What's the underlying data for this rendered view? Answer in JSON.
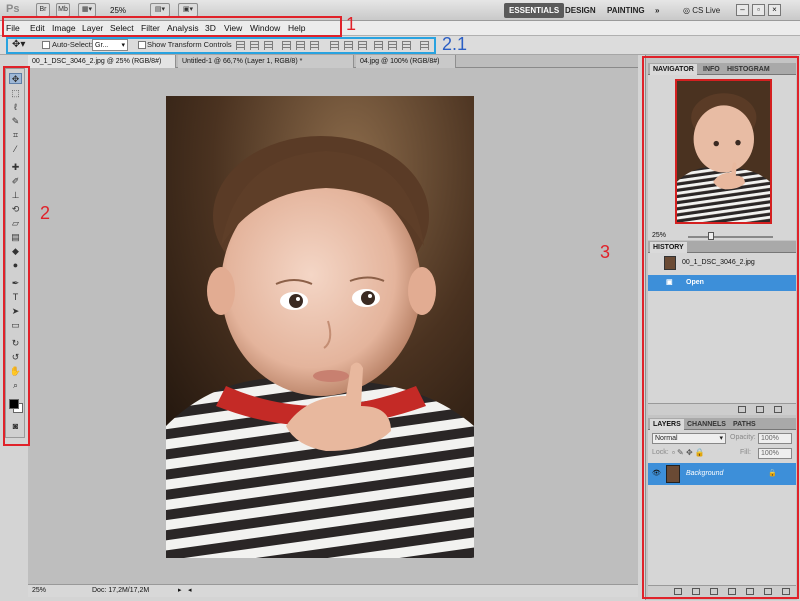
{
  "appbar": {
    "logo": "Ps",
    "zoom": "25%",
    "workspaces": [
      "ESSENTIALS",
      "DESIGN",
      "PAINTING"
    ],
    "more": "»",
    "cslive": "CS Live"
  },
  "menus": [
    "File",
    "Edit",
    "Image",
    "Layer",
    "Select",
    "Filter",
    "Analysis",
    "3D",
    "View",
    "Window",
    "Help"
  ],
  "options": {
    "auto_select_label": "Auto-Select:",
    "auto_select_value": "Gr...",
    "transform_label": "Show Transform Controls"
  },
  "tabs": [
    {
      "label": "00_1_DSC_3046_2.jpg @ 25% (RGB/8#)",
      "active": true
    },
    {
      "label": "Untitled-1 @ 66,7% (Layer 1, RGB/8) *",
      "active": false
    },
    {
      "label": "04.jpg @ 100% (RGB/8#)",
      "active": false
    }
  ],
  "status": {
    "zoom": "25%",
    "doc": "Doc: 17,2M/17,2M"
  },
  "navigator": {
    "tabs": [
      "NAVIGATOR",
      "INFO",
      "HISTOGRAM"
    ],
    "zoom": "25%"
  },
  "history": {
    "title": "HISTORY",
    "snapshot": "00_1_DSC_3046_2.jpg",
    "step": "Open"
  },
  "layers": {
    "tabs": [
      "LAYERS",
      "CHANNELS",
      "PATHS"
    ],
    "blend": "Normal",
    "opacity_label": "Opacity:",
    "opacity": "100%",
    "lock_label": "Lock:",
    "fill_label": "Fill:",
    "fill": "100%",
    "layer_name": "Background"
  },
  "annotations": {
    "a1": "1",
    "a21": "2.1",
    "a2": "2",
    "a3": "3"
  },
  "colors": {
    "annotation_red": "#e0222a",
    "annotation_blue": "#29a3e0",
    "selection_blue": "#3d8fd9"
  }
}
